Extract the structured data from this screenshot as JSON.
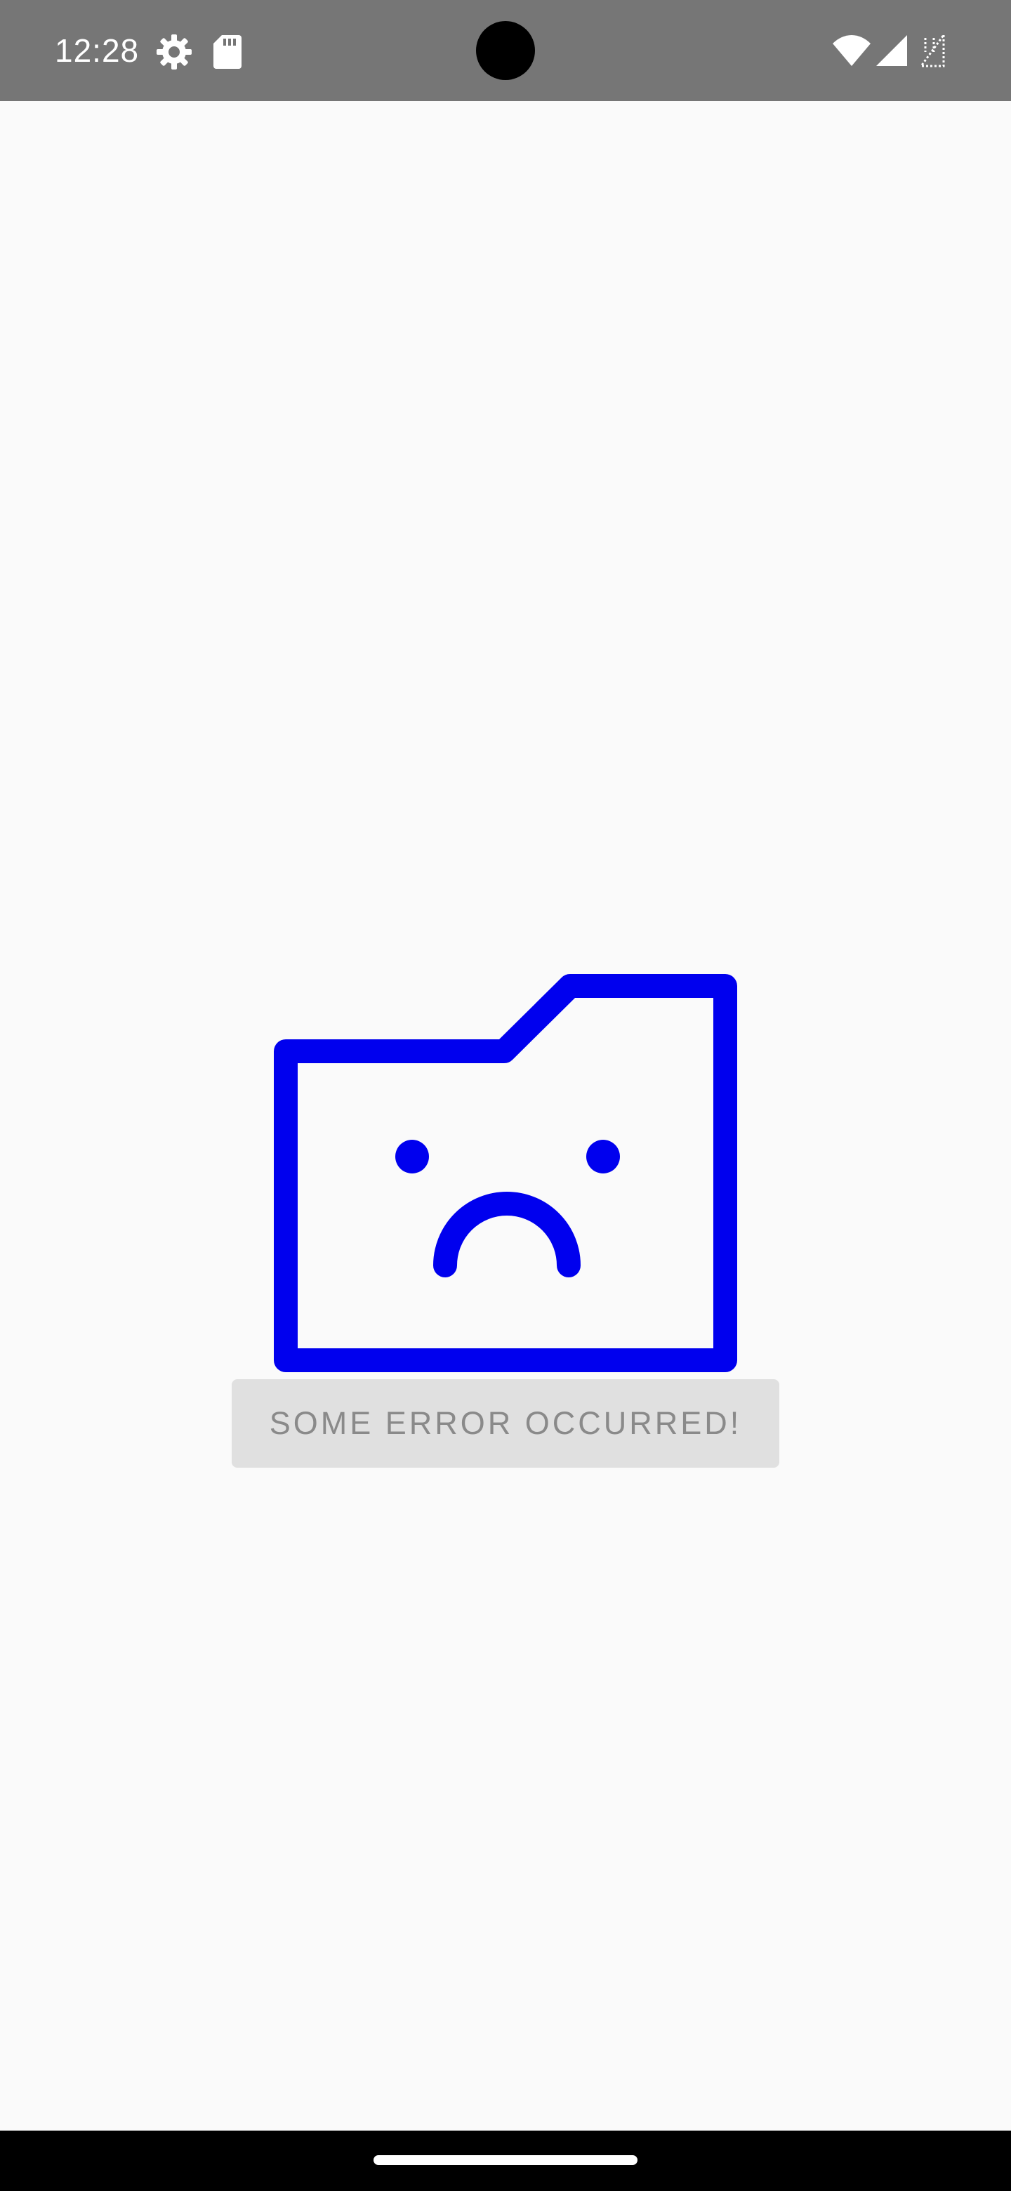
{
  "status_bar": {
    "time": "12:28",
    "icons": [
      "settings-gear-icon",
      "sd-card-icon",
      "wifi-icon",
      "cellular-signal-icon",
      "no-signal-icon"
    ],
    "background": "#767676"
  },
  "empty_state": {
    "illustration_icon": "sad-folder-icon",
    "illustration_color": "#0000ee",
    "message": "SOME ERROR OCCURRED!"
  },
  "colors": {
    "background": "#fafafa",
    "button_bg": "#e0e0e0",
    "button_text": "#8a8a8a"
  }
}
